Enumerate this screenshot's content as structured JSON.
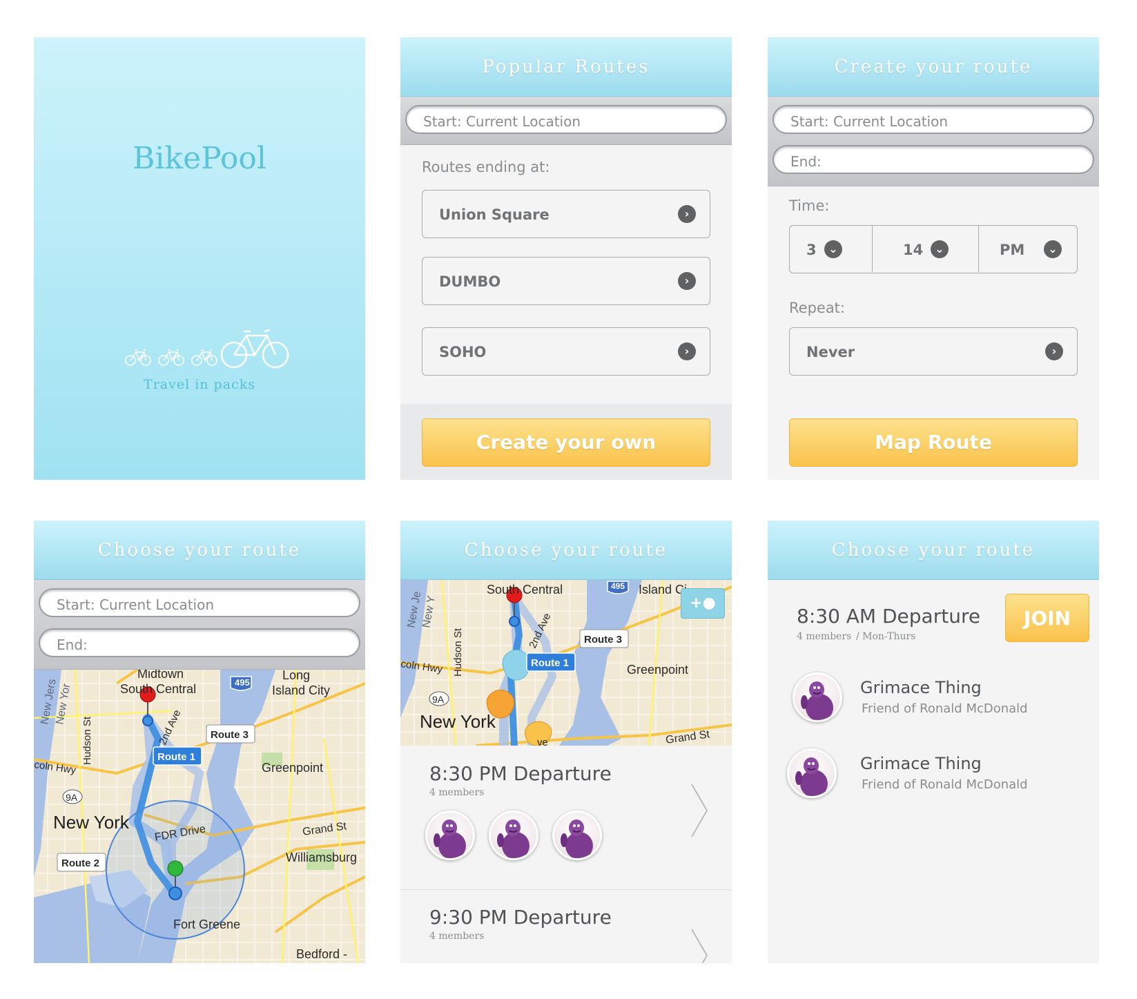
{
  "splash": {
    "brand": "BikePool",
    "tagline": "Travel in packs"
  },
  "popular": {
    "title": "Popular Routes",
    "start_placeholder": "Start: Current Location",
    "section_label": "Routes ending at:",
    "routes": [
      "Union Square",
      "DUMBO",
      "SOHO"
    ],
    "button": "Create your own"
  },
  "create": {
    "title": "Create your route",
    "start_placeholder": "Start: Current Location",
    "end_placeholder": "End:",
    "time_label": "Time:",
    "hour": "3",
    "minute": "14",
    "ampm": "PM",
    "repeat_label": "Repeat:",
    "repeat_value": "Never",
    "button": "Map Route"
  },
  "choose_map": {
    "title": "Choose your route",
    "start_placeholder": "Start: Current Location",
    "end_placeholder": "End:",
    "map": {
      "midtown": "Midtown",
      "south_central": "South Central",
      "long_island_city_1": "Long",
      "long_island_city_2": "Island City",
      "highway_495": "495",
      "hudson": "Hudson St",
      "second_ave": "2nd Ave",
      "lincoln_hwy": "coln Hwy",
      "greenpoint": "Greenpoint",
      "nine_a": "9A",
      "new_york": "New York",
      "new_jersey": "New Jers",
      "new_york_side": "New Yor",
      "fdr": "FDR Drive",
      "grand_st": "Grand St",
      "williamsburg": "Williamsburg",
      "fort_greene": "Fort Greene",
      "bedford": "Bedford -",
      "route1": "Route 1",
      "route2": "Route 2",
      "route3": "Route 3"
    }
  },
  "choose_list": {
    "title": "Choose your route",
    "map": {
      "south_central": "South Central",
      "highway_495": "495",
      "island": "Island Ci",
      "hudson": "Hudson St",
      "second_ave": "2nd Ave",
      "lincoln_hwy": "coln Hwy",
      "greenpoint": "Greenpoint",
      "nine_a": "9A",
      "new_york": "New York",
      "grand_st": "Grand St",
      "new_jersey": "New Je",
      "new_york_side": "New Y",
      "route1": "Route 1",
      "route3": "Route 3",
      "ave": "ve",
      "add_pin": "+"
    },
    "departures": [
      {
        "time": "8:30 PM Departure",
        "members": "4 members"
      },
      {
        "time": "9:30 PM Departure",
        "members": "4 members"
      }
    ]
  },
  "detail": {
    "title": "Choose your route",
    "departure": "8:30 AM Departure",
    "members": "4 members",
    "schedule": "/ Mon-Thurs",
    "join": "JOIN",
    "people": [
      {
        "name": "Grimace Thing",
        "desc": "Friend of Ronald McDonald"
      },
      {
        "name": "Grimace Thing",
        "desc": "Friend of Ronald McDonald"
      }
    ]
  },
  "colors": {
    "header_top": "#ccf3fb",
    "header_bottom": "#9cdbed",
    "brand": "#5cc3d8",
    "button_yellow": "#f9c24b",
    "route_blue": "#3f8fe0"
  }
}
